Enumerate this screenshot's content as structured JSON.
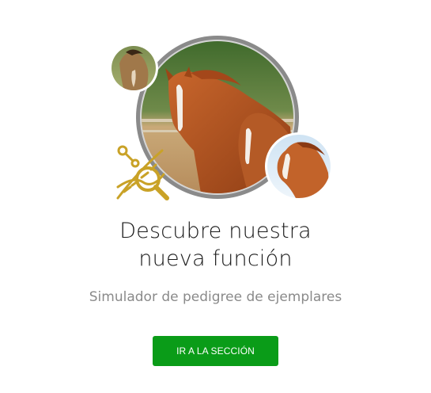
{
  "promo": {
    "title_line1": "Descubre nuestra",
    "title_line2": "nueva función",
    "subtitle": "Simulador de pedigree de ejemplares",
    "cta_label": "IR A LA SECCIÓN"
  },
  "icons": {
    "dna_search": "dna-magnifier-icon"
  },
  "colors": {
    "accent_green": "#0a9c18",
    "icon_gold": "#c9a227",
    "title_text": "#1a1a1a",
    "subtitle_text": "#8a8a8a"
  }
}
